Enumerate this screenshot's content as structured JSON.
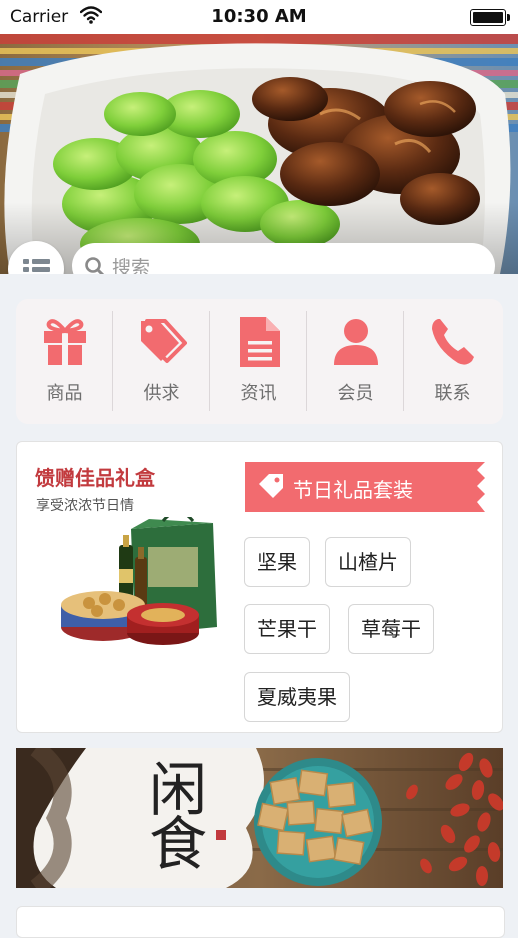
{
  "status_bar": {
    "carrier": "Carrier",
    "time": "10:30 AM"
  },
  "search": {
    "placeholder": "搜索"
  },
  "nav": {
    "accent": "#f26b6f",
    "items": [
      {
        "label": "商品",
        "icon": "gift-icon"
      },
      {
        "label": "供求",
        "icon": "tags-icon"
      },
      {
        "label": "资讯",
        "icon": "document-icon"
      },
      {
        "label": "会员",
        "icon": "user-icon"
      },
      {
        "label": "联系",
        "icon": "phone-icon"
      }
    ]
  },
  "gift_section": {
    "title": "馈赠佳品礼盒",
    "subtitle": "享受浓浓节日情",
    "ribbon_label": "节日礼品套装",
    "chips": [
      "坚果",
      "山楂片",
      "芒果干",
      "草莓干",
      "夏威夷果"
    ]
  },
  "banner": {
    "calligraphy": "闲食"
  }
}
